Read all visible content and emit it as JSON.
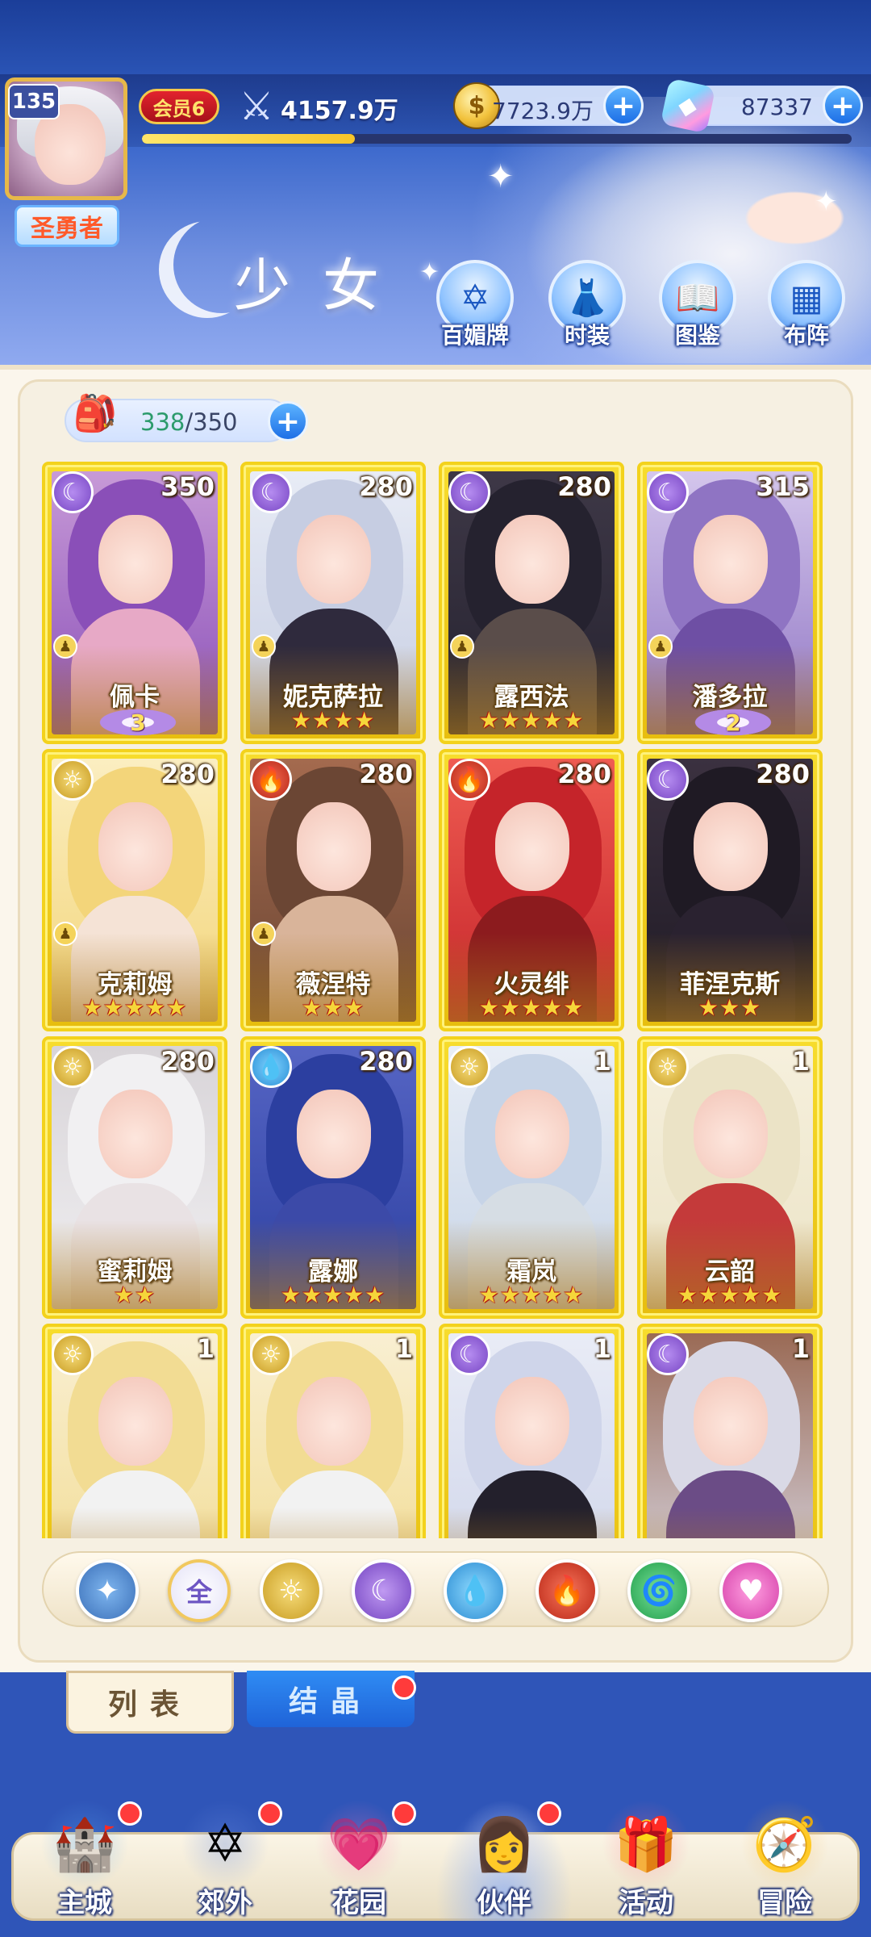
{
  "header": {
    "level": "135",
    "title_badge": "圣勇者",
    "vip": "会员6",
    "power": "4157.9万",
    "exp_progress": 0.3,
    "gold": "7723.9万",
    "gems": "87337",
    "page_title": "少女",
    "nav_buttons": [
      {
        "label": "百媚牌",
        "icon": "card-icon"
      },
      {
        "label": "时装",
        "icon": "outfit-icon"
      },
      {
        "label": "图鉴",
        "icon": "book-icon"
      },
      {
        "label": "布阵",
        "icon": "formation-icon"
      }
    ]
  },
  "capacity": {
    "current": "338",
    "max": "/350"
  },
  "cards": [
    {
      "name": "佩卡",
      "count": "350",
      "element": "dark",
      "stars": "",
      "awaken": "3",
      "art": [
        "#8a4fb8",
        "#c79ad7",
        "#e7a9c6"
      ]
    },
    {
      "name": "妮克萨拉",
      "count": "280",
      "element": "dark",
      "stars": "★★★★",
      "awaken": "",
      "art": [
        "#c6cde2",
        "#e8ecf6",
        "#2f2a3d"
      ]
    },
    {
      "name": "露西法",
      "count": "280",
      "element": "dark",
      "stars": "★★★★★",
      "awaken": "",
      "art": [
        "#25222f",
        "#3e3847",
        "#5a4d4a"
      ]
    },
    {
      "name": "潘多拉",
      "count": "315",
      "element": "dark",
      "stars": "",
      "awaken": "2",
      "art": [
        "#8f74c3",
        "#d4c6ec",
        "#6e4fa4"
      ]
    },
    {
      "name": "克莉姆",
      "count": "280",
      "element": "light",
      "stars": "★★★★★",
      "awaken": "",
      "art": [
        "#f3d57a",
        "#fbeec1",
        "#f5e3d6"
      ]
    },
    {
      "name": "薇涅特",
      "count": "280",
      "element": "fire",
      "stars": "★★★",
      "awaken": "",
      "art": [
        "#6b4634",
        "#a46a4e",
        "#d9b49a"
      ]
    },
    {
      "name": "火灵绯",
      "count": "280",
      "element": "fire",
      "stars": "★★★★★",
      "awaken": "",
      "art": [
        "#c5242a",
        "#ef5c52",
        "#8c1b1e"
      ]
    },
    {
      "name": "菲涅克斯",
      "count": "280",
      "element": "dark",
      "stars": "★★★",
      "awaken": "",
      "art": [
        "#1f1a24",
        "#3b3140",
        "#2a2230"
      ]
    },
    {
      "name": "蜜莉姆",
      "count": "280",
      "element": "light",
      "stars": "★★",
      "awaken": "",
      "art": [
        "#f1f0f2",
        "#d8d4d8",
        "#e9e2e4"
      ]
    },
    {
      "name": "露娜",
      "count": "280",
      "element": "water",
      "stars": "★★★★★",
      "awaken": "",
      "art": [
        "#2c3fa0",
        "#5665c4",
        "#3c4aa8"
      ]
    },
    {
      "name": "霜岚",
      "count": "1",
      "element": "light",
      "stars": "★★★★★",
      "awaken": "",
      "art": [
        "#c7d4e7",
        "#e9eef6",
        "#d6dde4"
      ]
    },
    {
      "name": "云韶",
      "count": "1",
      "element": "light",
      "stars": "★★★★★",
      "awaken": "",
      "art": [
        "#ebe3c6",
        "#f6f0dd",
        "#c43a3a"
      ]
    },
    {
      "name": "",
      "count": "1",
      "element": "light",
      "stars": "",
      "awaken": "",
      "art": [
        "#f2dc93",
        "#f9efd2",
        "#f2f2f2"
      ]
    },
    {
      "name": "",
      "count": "1",
      "element": "light",
      "stars": "",
      "awaken": "",
      "art": [
        "#f2dc93",
        "#f9efd2",
        "#f2f2f2"
      ]
    },
    {
      "name": "",
      "count": "1",
      "element": "dark",
      "stars": "",
      "awaken": "",
      "art": [
        "#cfd5ea",
        "#e9ecf6",
        "#23202c"
      ]
    },
    {
      "name": "",
      "count": "1",
      "element": "dark",
      "stars": "",
      "awaken": "",
      "art": [
        "#d9d9e6",
        "#9a6a55",
        "#6b4c86"
      ]
    }
  ],
  "filters": [
    {
      "key": "up",
      "icon": "star-compass-icon",
      "glyph": "✦"
    },
    {
      "key": "all",
      "icon": "all-filter-icon",
      "glyph": "全"
    },
    {
      "key": "light",
      "icon": "sun-element-icon",
      "glyph": "☼"
    },
    {
      "key": "dark",
      "icon": "moon-element-icon",
      "glyph": "☾"
    },
    {
      "key": "water",
      "icon": "water-element-icon",
      "glyph": "💧"
    },
    {
      "key": "fire",
      "icon": "fire-element-icon",
      "glyph": "🔥"
    },
    {
      "key": "wind",
      "icon": "wind-element-icon",
      "glyph": "🌀"
    },
    {
      "key": "love",
      "icon": "heart-element-icon",
      "glyph": "♥"
    }
  ],
  "tabs": {
    "list": "列表",
    "crystal": "结晶"
  },
  "bottom_nav": [
    {
      "label": "主城",
      "icon": "castle-icon",
      "glyph": "🏰",
      "dot": true
    },
    {
      "label": "郊外",
      "icon": "portal-icon",
      "glyph": "✡",
      "dot": true
    },
    {
      "label": "花园",
      "icon": "heart-garden-icon",
      "glyph": "💗",
      "dot": true
    },
    {
      "label": "伙伴",
      "icon": "partner-icon",
      "glyph": "👩",
      "dot": true
    },
    {
      "label": "活动",
      "icon": "gift-icon",
      "glyph": "🎁",
      "dot": false
    },
    {
      "label": "冒险",
      "icon": "compass-icon",
      "glyph": "🧭",
      "dot": false
    }
  ],
  "colors": {
    "card_gold": "#f3d21c",
    "accent_blue": "#1d6fe6",
    "badge_red": "#ff3b3b"
  }
}
